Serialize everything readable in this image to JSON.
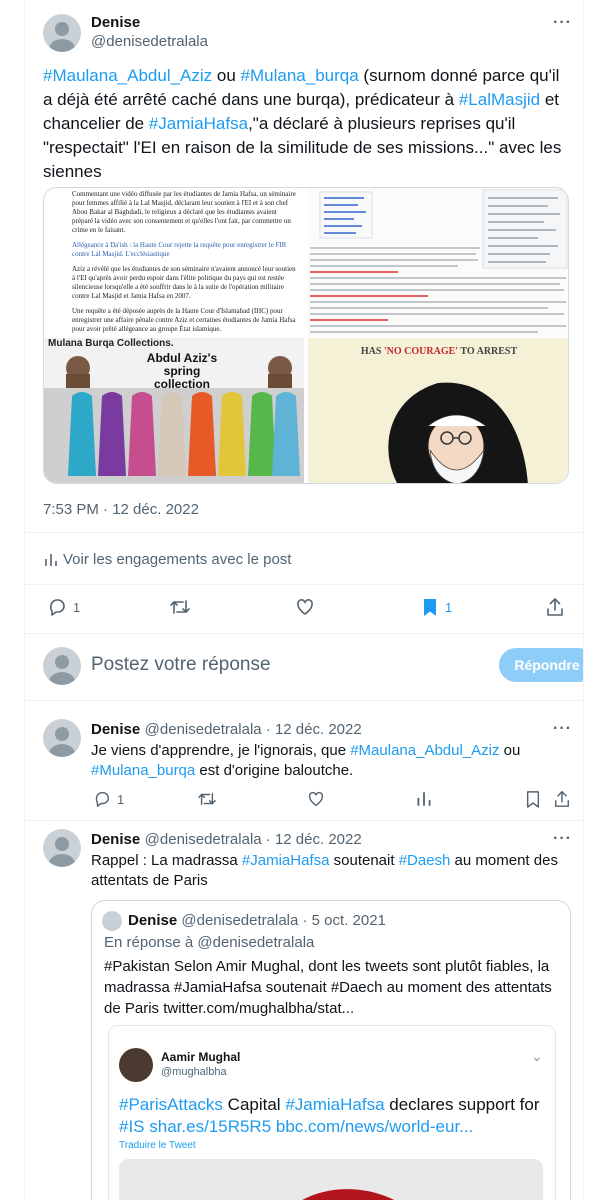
{
  "main_tweet": {
    "author_name": "Denise",
    "author_handle": "@denisedetralala",
    "text_parts": [
      {
        "t": "#Maulana_Abdul_Aziz",
        "link": true
      },
      {
        "t": " ou ",
        "link": false
      },
      {
        "t": "#Mulana_burqa",
        "link": true
      },
      {
        "t": " (surnom donné parce qu'il a déjà été arrêté caché dans une burqa), prédicateur à ",
        "link": false
      },
      {
        "t": "#LalMasjid",
        "link": true
      },
      {
        "t": " et chancelier de ",
        "link": false
      },
      {
        "t": "#JamiaHafsa",
        "link": true
      },
      {
        "t": ",\"a déclaré à plusieurs reprises qu'il \"respectait\" l'EI en raison de la similitude de ses missions...\" avec les siennes",
        "link": false
      }
    ],
    "media": {
      "article_lines": [
        "Commentant une vidéo diffusée par les étudiantes de Jamia Hafsa, un séminaire pour femmes affilié à la Lal Masjid, déclarant leur soutien à l'EI et à son chef Abou Bakar al Baghdadi, le religieux a déclaré que les étudiantes avaient préparé la vidéo avec son consentement et qu'elles l'ont fait, par commettre un crime en le faisant.",
        "Allégeance à Da'ish : la Haute Cour rejette la requête pour enregistrer le FIR contre Lal Masjid. L'ecclésiastique",
        "Aziz a révélé que les étudiantes de son séminaire n'avaient annoncé leur soutien à l'EI qu'après avoir perdu espoir dans l'élite politique du pays qui est restée silencieuse lorsqu'elle a été souffrir dans le à la suite de l'opération militaire contre Lal Masjid et Jamia Hafsa en 2007.",
        "Une requête a été déposée auprès de la Haute Cour d'Islamabad (IHC) pour enregistrer une affaire pénale contre Aziz et certaines étudiantes de Jamia Hafsa pour avoir prêté allégeance au groupe État islamique."
      ],
      "collection_caption": "Mulana Burqa Collections.",
      "collection_title": "Abdul Aziz's spring collection",
      "cartoon_caption_pre": "HAS ",
      "cartoon_caption_em": "'NO COURAGE'",
      "cartoon_caption_post": " TO ARREST"
    },
    "timestamp": "7:53 PM · 12 déc. 2022",
    "engagements_label": "Voir les engagements avec le post",
    "reply_count": "1",
    "bookmark_count": "1",
    "colors": {
      "accent": "#1d9bf0",
      "bookmark_active": "#1d9bf0",
      "muted": "#536471"
    }
  },
  "compose": {
    "placeholder": "Postez votre réponse",
    "button_label": "Répondre"
  },
  "reply1": {
    "author_name": "Denise",
    "meta": "@denisedetralala · 12 déc. 2022",
    "text_parts": [
      {
        "t": "Je viens d'apprendre, je l'ignorais, que ",
        "link": false
      },
      {
        "t": "#Maulana_Abdul_Aziz",
        "link": true
      },
      {
        "t": " ou ",
        "link": false
      },
      {
        "t": "#Mulana_burqa",
        "link": true
      },
      {
        "t": " est d'origine baloutche.",
        "link": false
      }
    ],
    "reply_count": "1"
  },
  "reply2": {
    "author_name": "Denise",
    "meta": "@denisedetralala · 12 déc. 2022",
    "text_parts": [
      {
        "t": "Rappel : La madrassa ",
        "link": false
      },
      {
        "t": "#JamiaHafsa",
        "link": true
      },
      {
        "t": " soutenait ",
        "link": false
      },
      {
        "t": "#Daesh",
        "link": true
      },
      {
        "t": " au moment des attentats de Paris",
        "link": false
      }
    ],
    "quote": {
      "author_name": "Denise",
      "meta": "@denisedetralala · 5 oct. 2021",
      "reply_to": "En réponse à @denisedetralala",
      "text": "#Pakistan Selon Amir Mughal, dont les tweets sont plutôt fiables, la madrassa #JamiaHafsa soutenait #Daech au moment des attentats de Paris  twitter.com/mughalbha/stat...",
      "embedded": {
        "author_name": "Aamir Mughal",
        "author_handle": "@mughalbha",
        "text_parts": [
          {
            "t": "#ParisAttacks",
            "link": true
          },
          {
            "t": " Capital ",
            "link": false
          },
          {
            "t": "#JamiaHafsa",
            "link": true
          },
          {
            "t": " declares support for ",
            "link": false
          },
          {
            "t": "#IS",
            "link": true
          },
          {
            "t": " shar.es/15R5R5 bbc.com/news/world-eur...",
            "link": true
          }
        ],
        "translate_label": "Traduire le Tweet"
      }
    }
  },
  "icons": [
    "more-icon",
    "reply-icon",
    "retweet-icon",
    "like-icon",
    "bookmark-icon",
    "share-icon",
    "analytics-icon"
  ]
}
